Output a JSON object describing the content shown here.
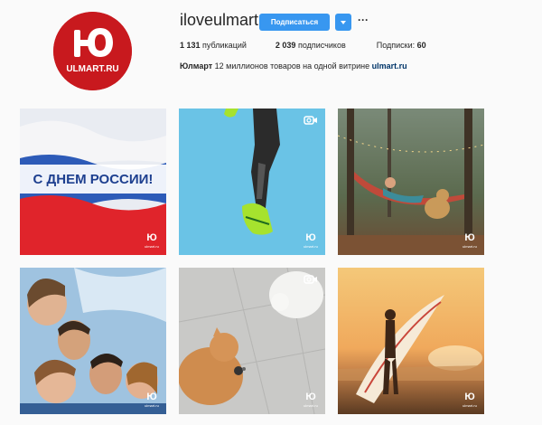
{
  "profile": {
    "username": "iloveulmart",
    "avatar_text": "ULMART.RU",
    "follow_label": "Подписаться",
    "more_label": "···",
    "stats": [
      {
        "count": "1 131",
        "label": "публикаций"
      },
      {
        "count": "2 039",
        "label": "подписчиков"
      },
      {
        "label": "Подписки:",
        "count": "60"
      }
    ],
    "bio": {
      "name": "Юлмарт",
      "text": "12 миллионов товаров на одной витрине",
      "site": "ulmart.ru"
    }
  },
  "posts": [
    {
      "caption": "С ДНЕМ РОССИИ!",
      "video": false,
      "badge": "ulmart.ru"
    },
    {
      "video": true,
      "badge": "ulmart.ru"
    },
    {
      "video": false,
      "badge": "ulmart.ru"
    },
    {
      "video": false,
      "badge": "ulmart.ru"
    },
    {
      "video": true,
      "badge": "ulmart.ru"
    },
    {
      "video": false,
      "badge": "ulmart.ru"
    }
  ],
  "colors": {
    "brand_red": "#c8191e",
    "follow_blue": "#3897f0",
    "link_blue": "#003569"
  },
  "icons": [
    "logo-icon",
    "chevron-down-icon",
    "video-camera-icon",
    "ulmart-badge-icon"
  ]
}
